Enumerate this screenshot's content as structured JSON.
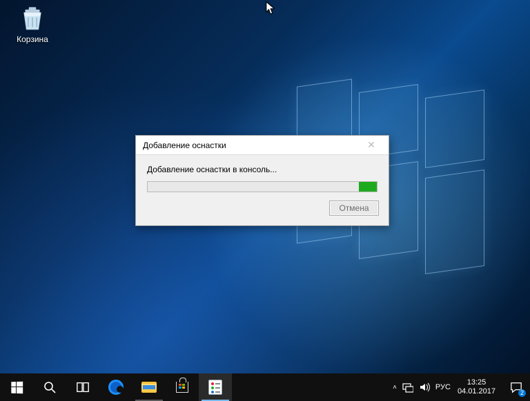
{
  "desktop": {
    "recycle_bin_label": "Корзина"
  },
  "dialog": {
    "title": "Добавление оснастки",
    "message": "Добавление оснастки в консоль...",
    "cancel_label": "Отмена",
    "close_glyph": "✕"
  },
  "tray": {
    "chevron": "˄",
    "lang": "РУС",
    "time": "13:25",
    "date": "04.01.2017",
    "notif_count": "2"
  }
}
